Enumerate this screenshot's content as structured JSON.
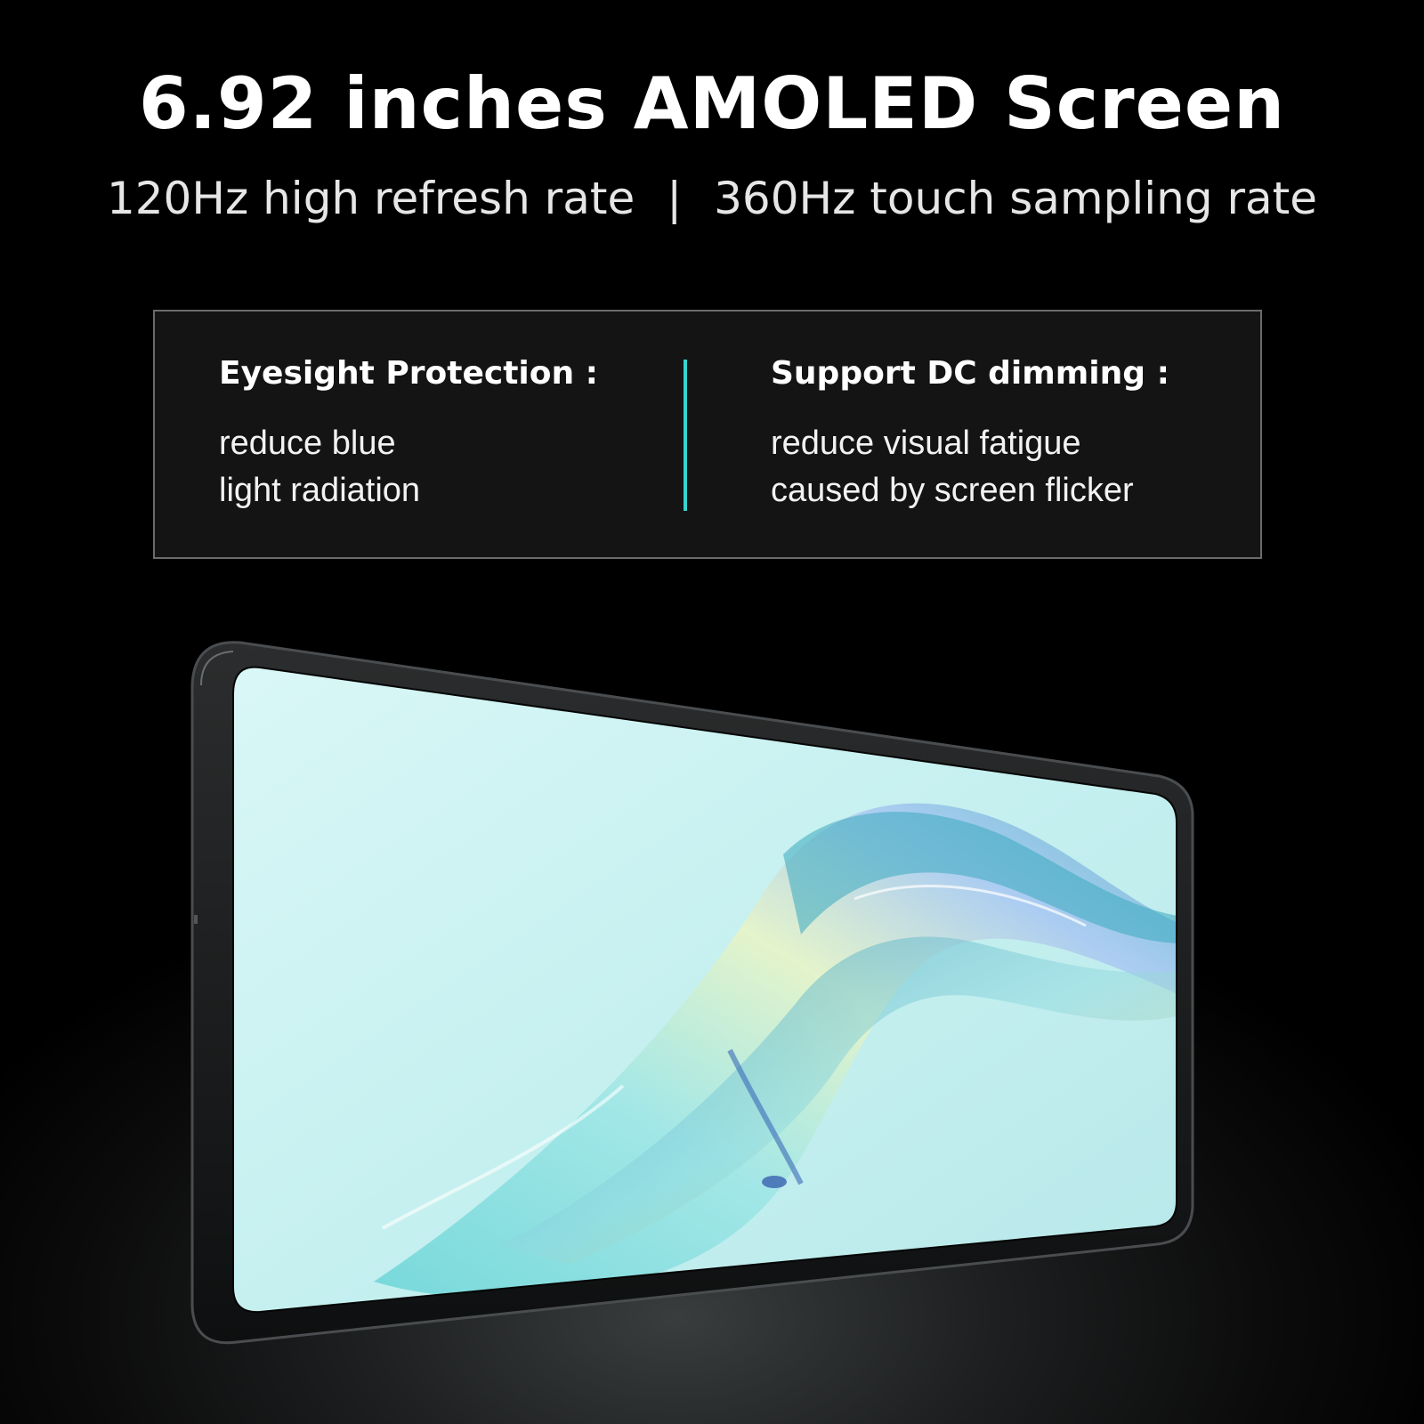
{
  "headline": "6.92 inches AMOLED Screen",
  "subline": {
    "left": "120Hz high refresh rate",
    "separator": "|",
    "right": "360Hz touch sampling rate"
  },
  "features": [
    {
      "title": "Eyesight Protection :",
      "lines": [
        "reduce blue",
        "light radiation"
      ]
    },
    {
      "title": "Support DC dimming :",
      "lines": [
        "reduce visual fatigue",
        "caused by screen flicker"
      ]
    }
  ],
  "colors": {
    "background": "#000000",
    "divider_accent": "#35d4cf",
    "box_border": "#6b6b6b"
  }
}
